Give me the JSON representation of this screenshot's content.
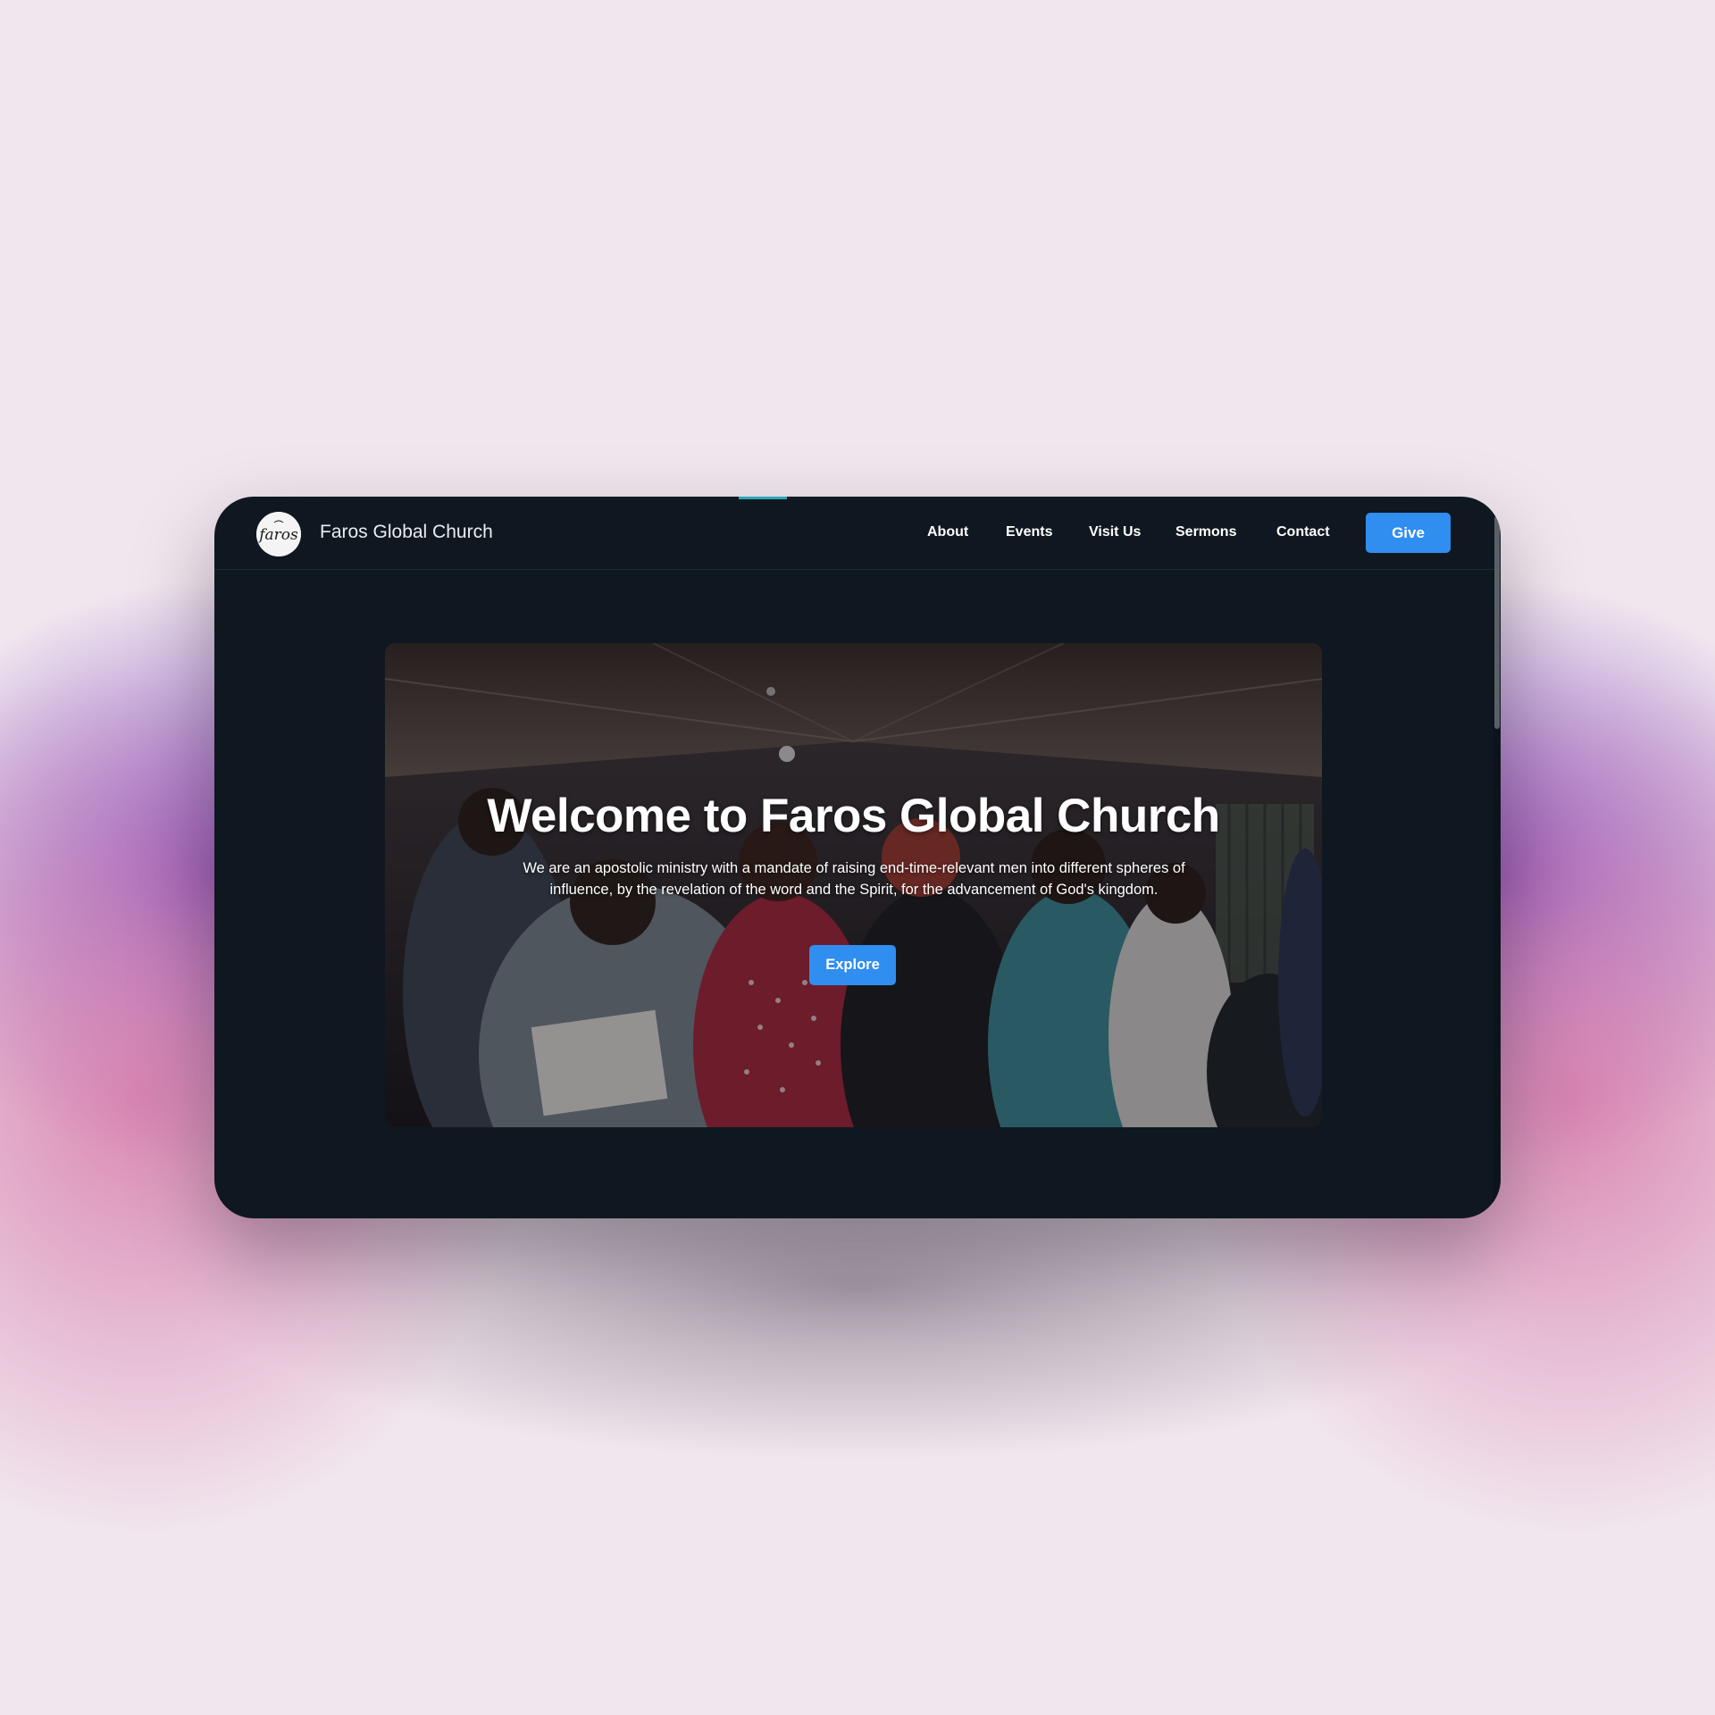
{
  "site": {
    "logo_text": "faros",
    "brand_name": "Faros Global Church"
  },
  "nav": {
    "items": [
      {
        "label": "About"
      },
      {
        "label": "Events"
      },
      {
        "label": "Visit Us"
      },
      {
        "label": "Sermons"
      },
      {
        "label": "Contact"
      }
    ],
    "give_label": "Give"
  },
  "hero": {
    "title": "Welcome to Faros Global Church",
    "description": "We are an apostolic ministry with a mandate of raising end-time-relevant men into different spheres of influence, by the revelation of the word and the Spirit, for the advancement of God's kingdom.",
    "cta_label": "Explore"
  },
  "colors": {
    "accent": "#2f8ef0",
    "page_background": "#0f1820",
    "top_indicator": "#2ba6b6"
  }
}
